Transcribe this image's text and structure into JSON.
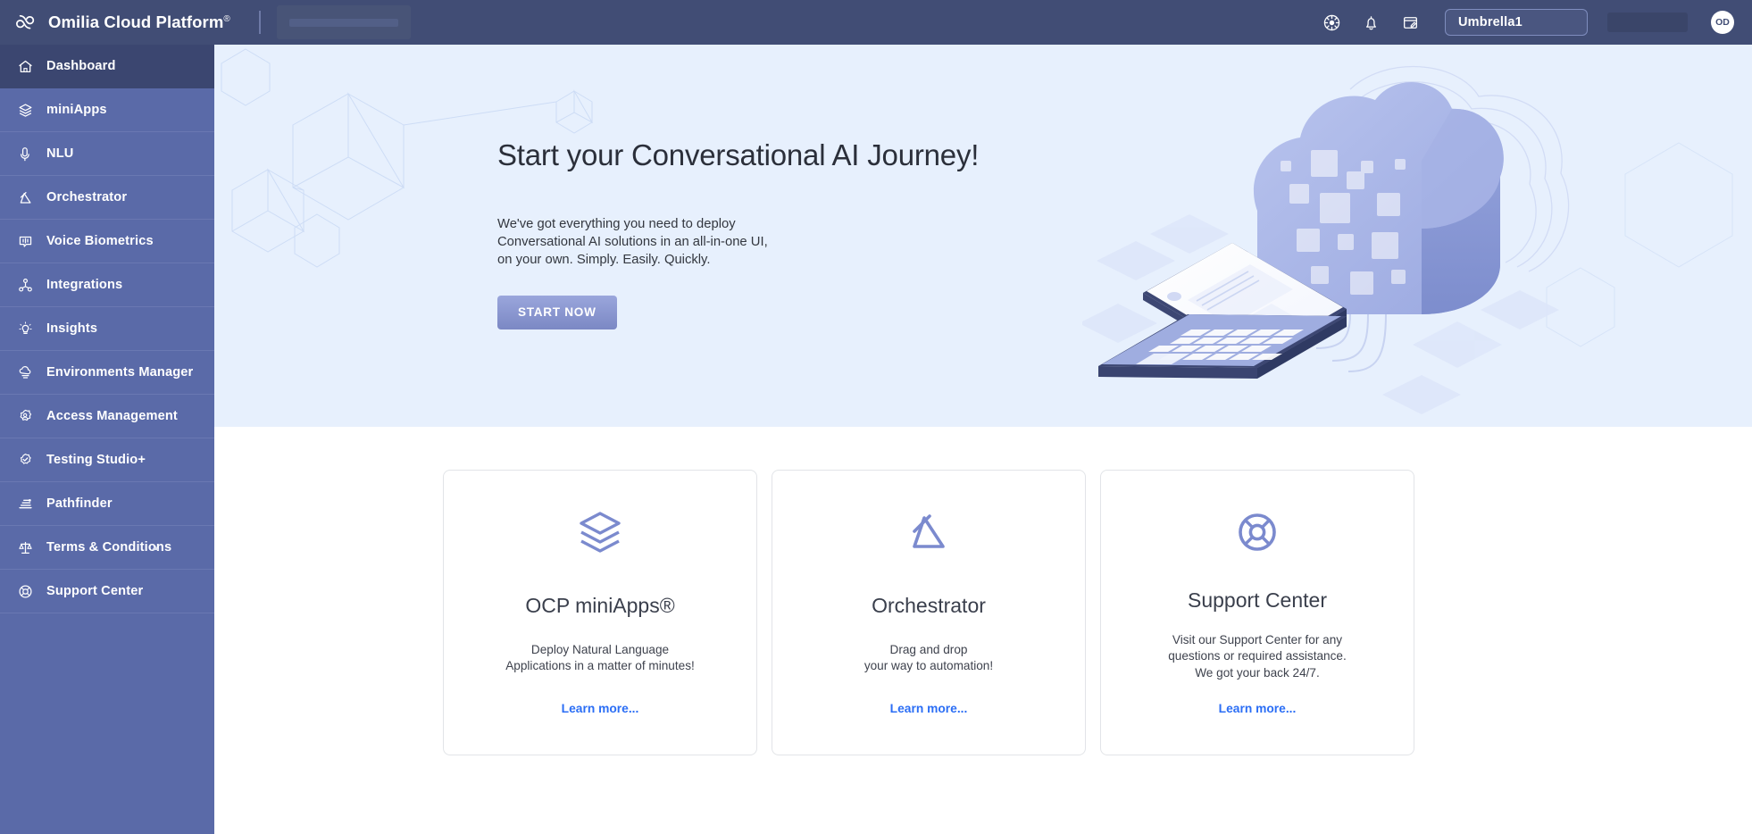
{
  "header": {
    "brand_name": "Omilia Cloud Platform",
    "brand_superscript": "®",
    "logo_icon": "cloud-icon",
    "icons": [
      {
        "name": "dashboard-widget-icon",
        "label": "Dashboard Widgets"
      },
      {
        "name": "bell-icon",
        "label": "Notifications"
      },
      {
        "name": "note-edit-icon",
        "label": "Notes"
      }
    ],
    "tenant_selector": {
      "value": "Umbrella1",
      "name": "tenant-selector"
    },
    "avatar_initials": "OD"
  },
  "sidebar": {
    "items": [
      {
        "label": "Dashboard",
        "icon": "home-icon",
        "active": true,
        "expandable": false
      },
      {
        "label": "miniApps",
        "icon": "layers-icon",
        "active": false,
        "expandable": false
      },
      {
        "label": "NLU",
        "icon": "microphone-icon",
        "active": false,
        "expandable": false
      },
      {
        "label": "Orchestrator",
        "icon": "orchestrator-icon",
        "active": false,
        "expandable": false
      },
      {
        "label": "Voice Biometrics",
        "icon": "voiceprint-icon",
        "active": false,
        "expandable": false
      },
      {
        "label": "Integrations",
        "icon": "nodes-icon",
        "active": false,
        "expandable": false
      },
      {
        "label": "Insights",
        "icon": "lightbulb-icon",
        "active": false,
        "expandable": false
      },
      {
        "label": "Environments Manager",
        "icon": "cloud-server-icon",
        "active": false,
        "expandable": false
      },
      {
        "label": "Access Management",
        "icon": "shield-user-icon",
        "active": false,
        "expandable": false
      },
      {
        "label": "Testing Studio+",
        "icon": "check-badge-icon",
        "active": false,
        "expandable": false
      },
      {
        "label": "Pathfinder",
        "icon": "pathfinder-icon",
        "active": false,
        "expandable": false
      },
      {
        "label": "Terms & Conditions",
        "icon": "scales-icon",
        "active": false,
        "expandable": true
      },
      {
        "label": "Support Center",
        "icon": "lifebuoy-icon",
        "active": false,
        "expandable": false
      }
    ]
  },
  "hero": {
    "title": "Start your Conversational AI Journey!",
    "subtitle_line1": "We've got everything you need to deploy",
    "subtitle_line2": "Conversational AI solutions in an all-in-one UI,",
    "subtitle_line3": "on your own. Simply. Easily. Quickly.",
    "cta_label": "START NOW",
    "illustration": "isometric-laptop-cloud-illustration"
  },
  "cards": [
    {
      "icon": "layers-icon",
      "title": "OCP miniApps®",
      "desc_line1": "Deploy Natural Language",
      "desc_line2": "Applications in a matter of minutes!",
      "link_label": "Learn more..."
    },
    {
      "icon": "orchestrator-icon",
      "title": "Orchestrator",
      "desc_line1": "Drag and drop",
      "desc_line2": "your way to automation!",
      "link_label": "Learn more..."
    },
    {
      "icon": "lifebuoy-icon",
      "title": "Support Center",
      "desc_line1": "Visit our Support Center for any",
      "desc_line2": "questions or required assistance.",
      "desc_line3": "We got your back 24/7.",
      "link_label": "Learn more..."
    }
  ],
  "colors": {
    "topbar": "#414d75",
    "sidebar": "#5a6aa8",
    "sidebar_active": "#3b4670",
    "hero_bg": "#e7f0fd",
    "accent": "#7b88c4",
    "link": "#2b6ef5",
    "card_border": "#e2e4e8"
  }
}
